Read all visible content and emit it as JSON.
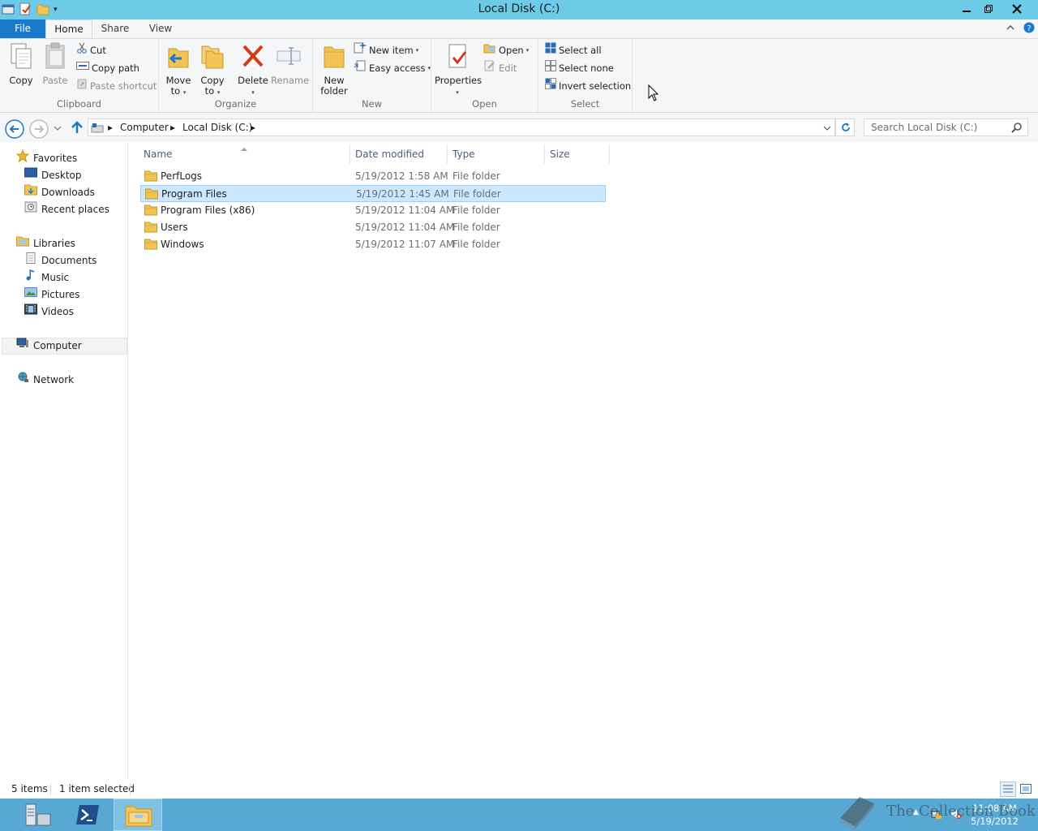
{
  "window": {
    "title": "Local Disk (C:)",
    "minimize": "🗕",
    "restore": "🗗",
    "close": "✕"
  },
  "ribbon_tabs": [
    "File",
    "Home",
    "Share",
    "View"
  ],
  "ribbon": {
    "clipboard": {
      "label": "Clipboard",
      "copy": "Copy",
      "paste": "Paste",
      "cut": "Cut",
      "copy_path": "Copy path",
      "paste_shortcut": "Paste shortcut"
    },
    "organize": {
      "label": "Organize",
      "move_to_1": "Move",
      "move_to_2": "to",
      "copy_to_1": "Copy",
      "copy_to_2": "to",
      "delete": "Delete",
      "rename": "Rename"
    },
    "new": {
      "label": "New",
      "new_folder_1": "New",
      "new_folder_2": "folder",
      "new_item": "New item",
      "easy_access": "Easy access"
    },
    "open": {
      "label": "Open",
      "properties": "Properties",
      "open": "Open",
      "edit": "Edit"
    },
    "select": {
      "label": "Select",
      "select_all": "Select all",
      "select_none": "Select none",
      "invert_selection": "Invert selection"
    }
  },
  "address": {
    "crumbs": [
      "Computer",
      "Local Disk (C:)"
    ],
    "search_placeholder": "Search Local Disk (C:)"
  },
  "nav": {
    "favorites": "Favorites",
    "desktop": "Desktop",
    "downloads": "Downloads",
    "recent": "Recent places",
    "libraries": "Libraries",
    "documents": "Documents",
    "music": "Music",
    "pictures": "Pictures",
    "videos": "Videos",
    "computer": "Computer",
    "network": "Network"
  },
  "columns": {
    "name": "Name",
    "date": "Date modified",
    "type": "Type",
    "size": "Size"
  },
  "files": [
    {
      "name": "PerfLogs",
      "date": "5/19/2012 1:58 AM",
      "type": "File folder"
    },
    {
      "name": "Program Files",
      "date": "5/19/2012 1:45 AM",
      "type": "File folder"
    },
    {
      "name": "Program Files (x86)",
      "date": "5/19/2012 11:04 AM",
      "type": "File folder"
    },
    {
      "name": "Users",
      "date": "5/19/2012 11:04 AM",
      "type": "File folder"
    },
    {
      "name": "Windows",
      "date": "5/19/2012 11:07 AM",
      "type": "File folder"
    }
  ],
  "selected_file_index": 1,
  "status": {
    "items": "5 items",
    "selected": "1 item selected"
  },
  "taskbar": {
    "time": "11:08 AM",
    "date": "5/19/2012"
  },
  "watermark": "The Collection Book",
  "colors": {
    "titlebar": "#6bcbe8",
    "file_tab": "#1979ca",
    "selection": "#cce8ff",
    "taskbar": "#58a8d6"
  }
}
